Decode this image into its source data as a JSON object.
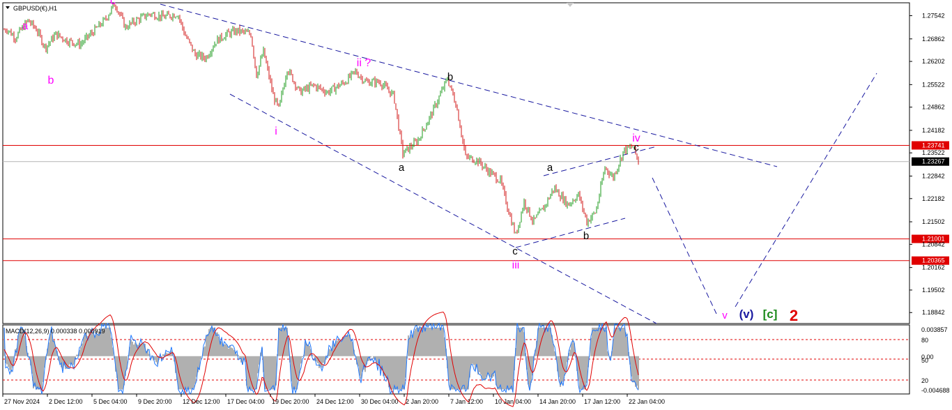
{
  "window": {
    "title": "GBPUSD(€),H1",
    "menu_arrow": "dropdown-triangle-icon"
  },
  "main": {
    "price_ticks": [
      "1.27542",
      "1.26862",
      "1.26202",
      "1.25522",
      "1.24862",
      "1.24182",
      "1.23522",
      "1.22842",
      "1.22182",
      "1.21502",
      "1.20842",
      "1.20162",
      "1.19502",
      "1.18842"
    ],
    "levels": [
      {
        "price": 1.23741,
        "label": "1.23741",
        "color": "#e00000"
      },
      {
        "price": 1.21001,
        "label": "1.21001",
        "color": "#e00000"
      },
      {
        "price": 1.20365,
        "label": "1.20365",
        "color": "#e00000"
      }
    ],
    "current": {
      "price": 1.23267,
      "label": "1.23267"
    },
    "wave_labels": [
      {
        "text": "a",
        "color": "#ff00ff"
      },
      {
        "text": "b",
        "color": "#ff00ff"
      },
      {
        "text": "c",
        "color": "#ff00ff"
      },
      {
        "text": "i",
        "color": "#ff00ff"
      },
      {
        "text": "ii ?",
        "color": "#ff00ff"
      },
      {
        "text": "a",
        "color": "#000000"
      },
      {
        "text": "b",
        "color": "#000000"
      },
      {
        "text": "c",
        "color": "#000000"
      },
      {
        "text": "iii",
        "color": "#ff00ff"
      },
      {
        "text": "a",
        "color": "#000000"
      },
      {
        "text": "b",
        "color": "#000000"
      },
      {
        "text": "iv",
        "color": "#ff00ff"
      },
      {
        "text": "c",
        "color": "#000000"
      },
      {
        "text": "v",
        "color": "#ff00ff"
      },
      {
        "text": "(v)",
        "color": "#1a1aa0"
      },
      {
        "text": "[c]",
        "color": "#1a8a1a"
      },
      {
        "text": "2",
        "color": "#e00000"
      }
    ]
  },
  "indicator": {
    "label": "MACD(12,26,9) 0.000338 0.000919",
    "ticks": [
      "0.003857",
      "80",
      "0.00",
      "50",
      "20",
      "-0.004688"
    ]
  },
  "time_axis": [
    "27 Nov 2024",
    "2 Dec 12:00",
    "5 Dec 04:00",
    "9 Dec 20:00",
    "12 Dec 12:00",
    "17 Dec 04:00",
    "19 Dec 20:00",
    "24 Dec 12:00",
    "30 Dec 04:00",
    "2 Jan 20:00",
    "7 Jan 12:00",
    "10 Jan 04:00",
    "14 Jan 20:00",
    "17 Jan 12:00",
    "22 Jan 04:00"
  ],
  "colors": {
    "bull": "#1a9a1a",
    "bear": "#d21414",
    "trend": "#1a1aa0",
    "macd_hist": "#b0b0b0",
    "macd_signal": "#e00000",
    "macd_line": "#1e78ff"
  },
  "chart_data": {
    "type": "candlestick",
    "title": "GBPUSD(€),H1",
    "ylim": [
      1.1852,
      1.2792
    ],
    "approx_path": [
      [
        0,
        1.271
      ],
      [
        10,
        1.2715
      ],
      [
        22,
        1.269
      ],
      [
        40,
        1.274
      ],
      [
        52,
        1.2715
      ],
      [
        65,
        1.266
      ],
      [
        80,
        1.27
      ],
      [
        98,
        1.268
      ],
      [
        115,
        1.267
      ],
      [
        130,
        1.27
      ],
      [
        150,
        1.274
      ],
      [
        165,
        1.279
      ],
      [
        180,
        1.272
      ],
      [
        195,
        1.274
      ],
      [
        215,
        1.276
      ],
      [
        235,
        1.275
      ],
      [
        255,
        1.276
      ],
      [
        265,
        1.27
      ],
      [
        280,
        1.264
      ],
      [
        295,
        1.263
      ],
      [
        310,
        1.268
      ],
      [
        325,
        1.27
      ],
      [
        340,
        1.271
      ],
      [
        360,
        1.27
      ],
      [
        368,
        1.258
      ],
      [
        378,
        1.265
      ],
      [
        392,
        1.252
      ],
      [
        400,
        1.248
      ],
      [
        412,
        1.26
      ],
      [
        430,
        1.253
      ],
      [
        450,
        1.255
      ],
      [
        470,
        1.253
      ],
      [
        495,
        1.256
      ],
      [
        510,
        1.259
      ],
      [
        525,
        1.256
      ],
      [
        545,
        1.256
      ],
      [
        565,
        1.252
      ],
      [
        578,
        1.235
      ],
      [
        600,
        1.239
      ],
      [
        620,
        1.247
      ],
      [
        642,
        1.257
      ],
      [
        655,
        1.249
      ],
      [
        668,
        1.234
      ],
      [
        685,
        1.233
      ],
      [
        700,
        1.23
      ],
      [
        718,
        1.227
      ],
      [
        730,
        1.218
      ],
      [
        740,
        1.211
      ],
      [
        752,
        1.221
      ],
      [
        765,
        1.215
      ],
      [
        780,
        1.219
      ],
      [
        795,
        1.225
      ],
      [
        815,
        1.22
      ],
      [
        830,
        1.223
      ],
      [
        842,
        1.215
      ],
      [
        855,
        1.218
      ],
      [
        868,
        1.231
      ],
      [
        880,
        1.228
      ],
      [
        895,
        1.236
      ],
      [
        908,
        1.237
      ],
      [
        916,
        1.2327
      ]
    ],
    "macd": {
      "last": 0.000338,
      "signal": 0.000919,
      "ylim": [
        -0.004688,
        0.003857
      ]
    }
  }
}
